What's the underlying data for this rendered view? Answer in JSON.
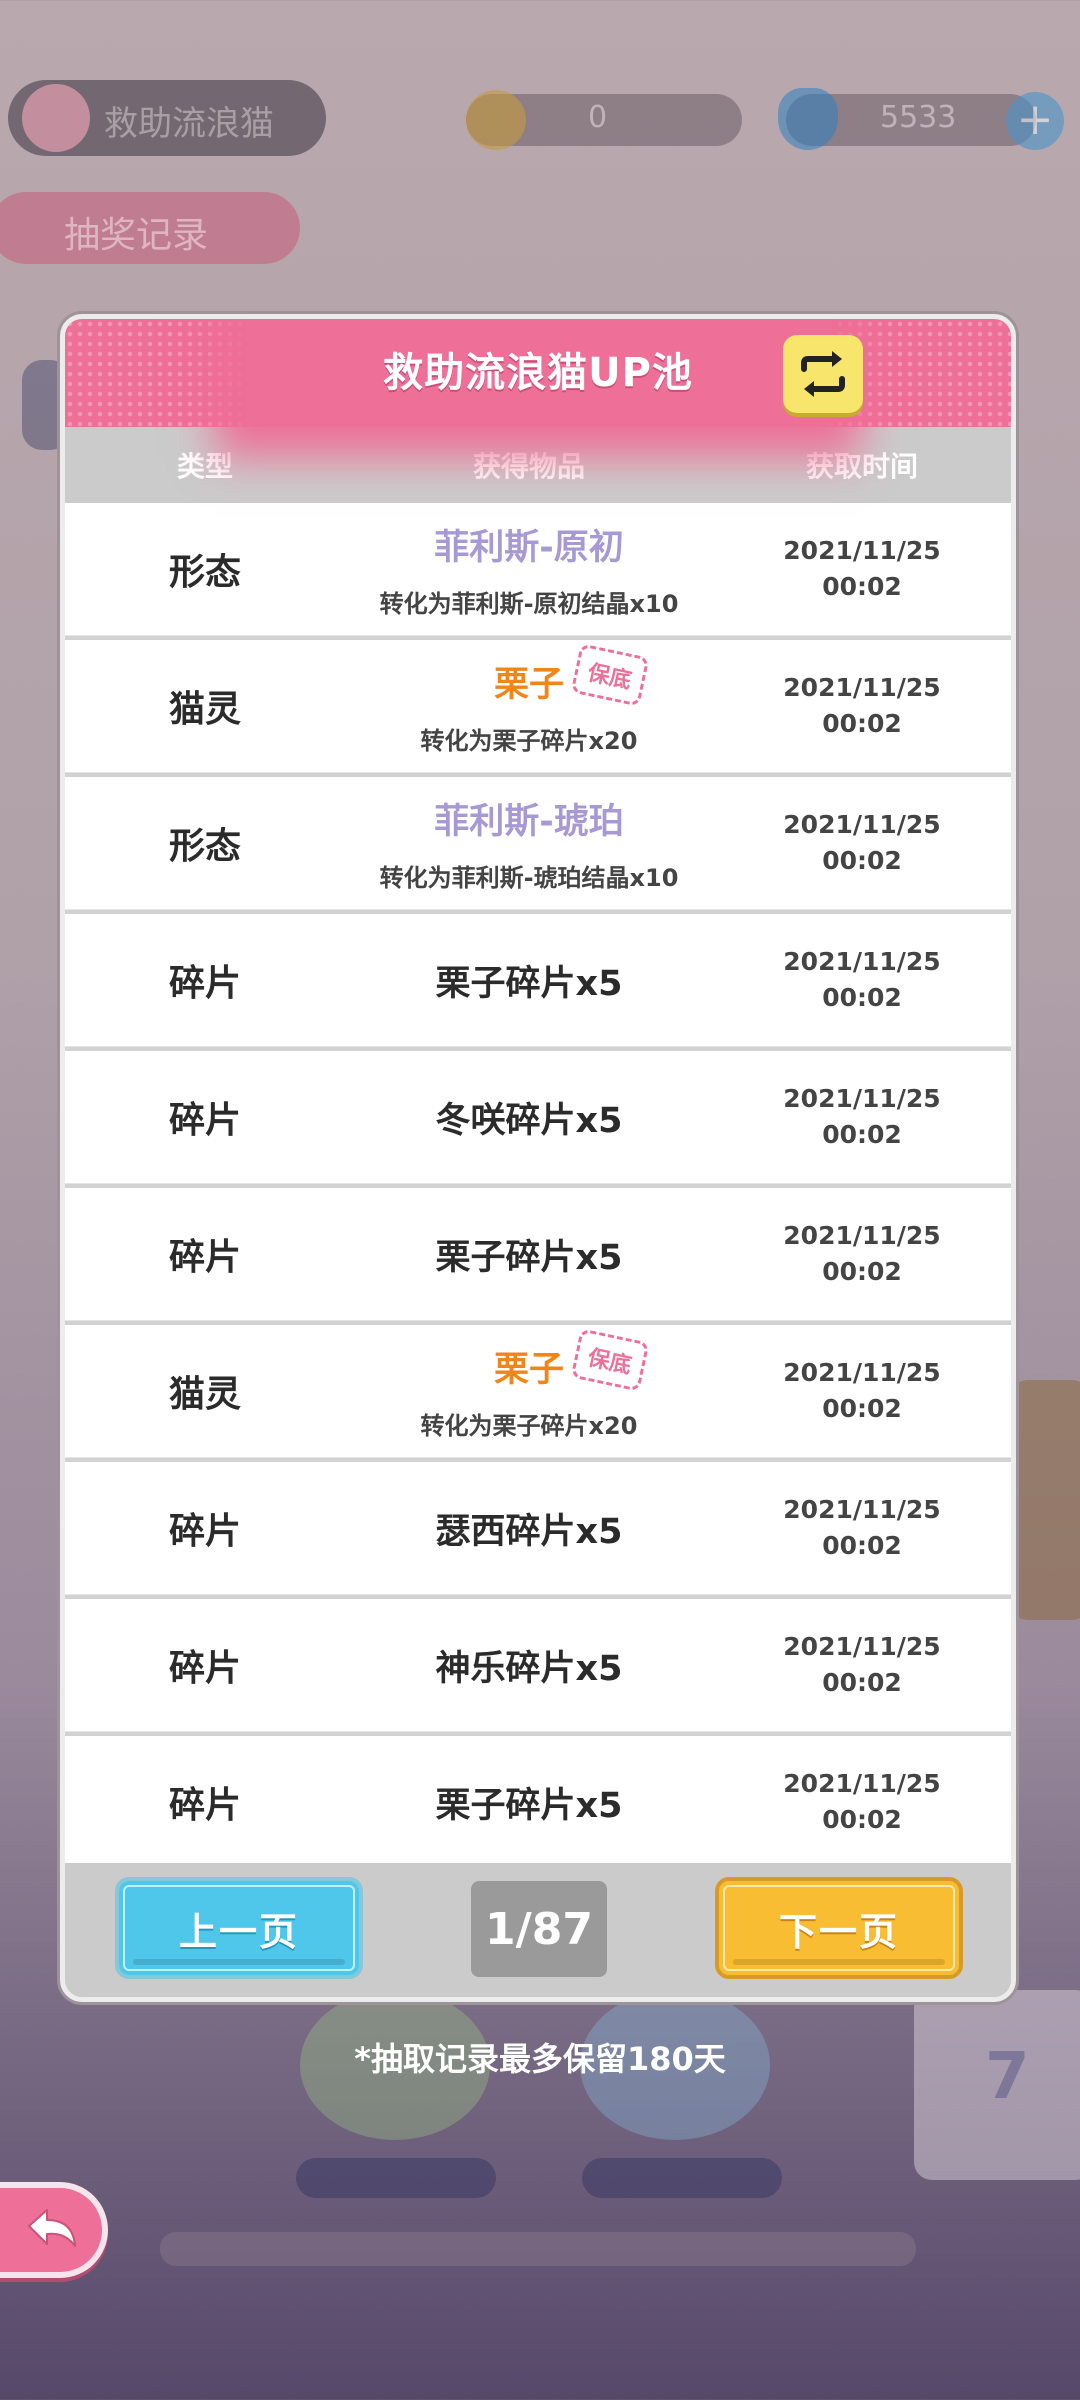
{
  "background": {
    "title_label": "救助流浪猫",
    "coin_value": "0",
    "gem_value": "5533",
    "record_tab_label": "抽奖记录",
    "ad_number": "7"
  },
  "modal": {
    "title": "救助流浪猫UP池",
    "columns": {
      "type": "类型",
      "item": "获得物品",
      "time": "获取时间"
    },
    "rows": [
      {
        "type": "形态",
        "item": "菲利斯-原初",
        "sub": "转化为菲利斯-原初结晶x10",
        "date": "2021/11/25",
        "time": "00:02"
      },
      {
        "type": "猫灵",
        "item": "栗子",
        "badge": "保底",
        "sub": "转化为栗子碎片x20",
        "date": "2021/11/25",
        "time": "00:02"
      },
      {
        "type": "形态",
        "item": "菲利斯-琥珀",
        "sub": "转化为菲利斯-琥珀结晶x10",
        "date": "2021/11/25",
        "time": "00:02"
      },
      {
        "type": "碎片",
        "item": "栗子碎片x5",
        "date": "2021/11/25",
        "time": "00:02"
      },
      {
        "type": "碎片",
        "item": "冬咲碎片x5",
        "date": "2021/11/25",
        "time": "00:02"
      },
      {
        "type": "碎片",
        "item": "栗子碎片x5",
        "date": "2021/11/25",
        "time": "00:02"
      },
      {
        "type": "猫灵",
        "item": "栗子",
        "badge": "保底",
        "sub": "转化为栗子碎片x20",
        "date": "2021/11/25",
        "time": "00:02"
      },
      {
        "type": "碎片",
        "item": "瑟西碎片x5",
        "date": "2021/11/25",
        "time": "00:02"
      },
      {
        "type": "碎片",
        "item": "神乐碎片x5",
        "date": "2021/11/25",
        "time": "00:02"
      },
      {
        "type": "碎片",
        "item": "栗子碎片x5",
        "date": "2021/11/25",
        "time": "00:02"
      }
    ],
    "pager": {
      "prev": "上一页",
      "next": "下一页",
      "indicator": "1/87"
    }
  },
  "note": "*抽取记录最多保留180天",
  "colors": {
    "header_pink": "#ee6f97",
    "purple_item": "#a79ad4",
    "orange_item": "#f08618",
    "prev_blue": "#4fc7ea",
    "next_yellow": "#f8bd32"
  },
  "icons": {
    "switch": "switch-arrows-icon",
    "back": "back-arrow-icon"
  }
}
